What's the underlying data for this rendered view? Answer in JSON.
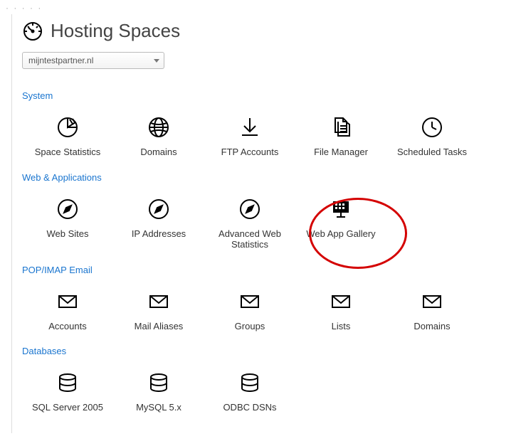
{
  "page": {
    "title": "Hosting Spaces"
  },
  "spaceSelect": {
    "selected": "mijntestpartner.nl"
  },
  "sections": {
    "system": {
      "label": "System",
      "items": [
        {
          "label": "Space Statistics"
        },
        {
          "label": "Domains"
        },
        {
          "label": "FTP Accounts"
        },
        {
          "label": "File Manager"
        },
        {
          "label": "Scheduled Tasks"
        }
      ]
    },
    "web": {
      "label": "Web & Applications",
      "items": [
        {
          "label": "Web Sites"
        },
        {
          "label": "IP Addresses"
        },
        {
          "label": "Advanced Web Statistics"
        },
        {
          "label": "Web App Gallery"
        }
      ]
    },
    "email": {
      "label": "POP/IMAP Email",
      "items": [
        {
          "label": "Accounts"
        },
        {
          "label": "Mail Aliases"
        },
        {
          "label": "Groups"
        },
        {
          "label": "Lists"
        },
        {
          "label": "Domains"
        }
      ]
    },
    "db": {
      "label": "Databases",
      "items": [
        {
          "label": "SQL Server 2005"
        },
        {
          "label": "MySQL 5.x"
        },
        {
          "label": "ODBC DSNs"
        }
      ]
    }
  }
}
